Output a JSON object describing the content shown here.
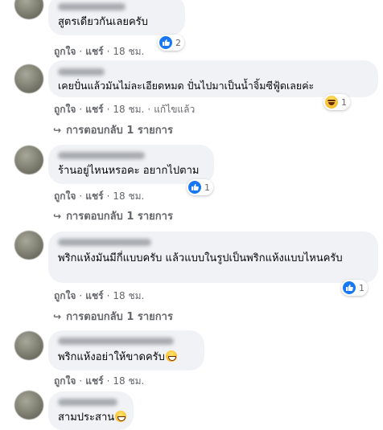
{
  "comments": [
    {
      "text": "สูตรเดียวกันเลยครับ",
      "like": "ถูกใจ",
      "share": "แชร์",
      "time": "18 ชม.",
      "reaction_count": "2",
      "reaction": "like-icon"
    },
    {
      "text": "เคยปั่นแล้วมันไม่ละเอียดหมด ปั่นไปมาเป็นน้ำจิ้มซีฟู้ดเลยค่ะ",
      "like": "ถูกใจ",
      "share": "แชร์",
      "time": "18 ชม.",
      "edited": "แก้ไขแล้ว",
      "reaction_count": "1",
      "reaction": "haha-icon",
      "replies": "การตอบกลับ 1 รายการ"
    },
    {
      "text": "ร้านอยู่ไหนหรอคะ อยากไปตาม",
      "like": "ถูกใจ",
      "share": "แชร์",
      "time": "18 ชม.",
      "reaction_count": "1",
      "reaction": "like-icon",
      "replies": "การตอบกลับ 1 รายการ"
    },
    {
      "text": "พริกแห้งมันมีกี่แบบครับ แล้วแบบในรูปเป็นพริกแห้งแบบไหนครับ",
      "like": "ถูกใจ",
      "share": "แชร์",
      "time": "18 ชม.",
      "reaction_count": "1",
      "reaction": "like-icon",
      "replies": "การตอบกลับ 1 รายการ"
    },
    {
      "text": "พริกแห้งอย่าให้ขาดครับ",
      "like": "ถูกใจ",
      "share": "แชร์",
      "time": "18 ชม."
    },
    {
      "text": "สามประสาน"
    }
  ],
  "colors": {
    "accent": "#1877f2",
    "bubble": "#f0f2f5",
    "meta": "#65676b"
  }
}
